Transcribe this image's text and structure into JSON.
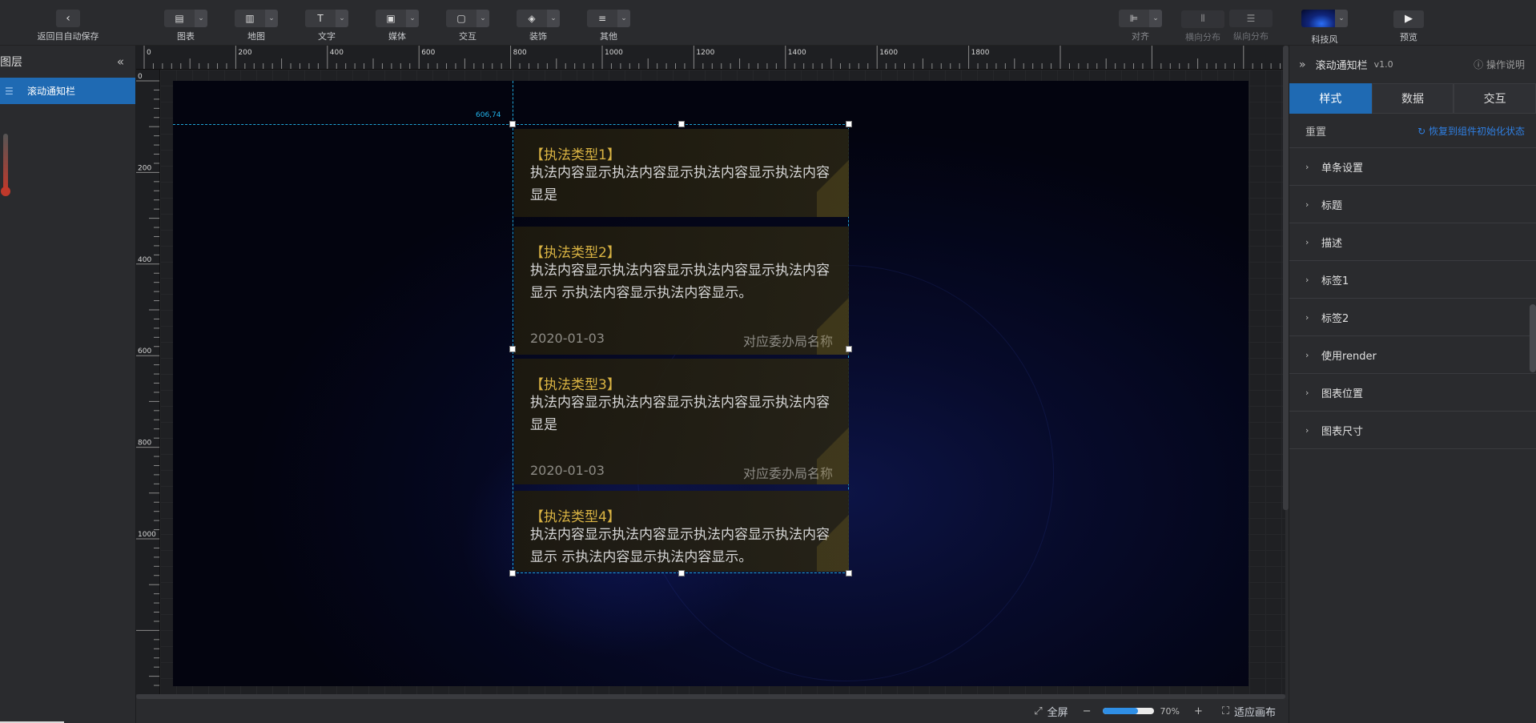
{
  "toolbar": {
    "back_label": "返回目自动保存",
    "groups": [
      {
        "label": "图表",
        "icon": "chart-icon"
      },
      {
        "label": "地图",
        "icon": "map-icon"
      },
      {
        "label": "文字",
        "icon": "text-icon"
      },
      {
        "label": "媒体",
        "icon": "media-icon"
      },
      {
        "label": "交互",
        "icon": "interact-icon"
      },
      {
        "label": "装饰",
        "icon": "decoration-icon"
      },
      {
        "label": "其他",
        "icon": "other-icon"
      }
    ],
    "align_label": "对齐",
    "hdist_label": "横向分布",
    "vdist_label": "纵向分布",
    "theme_label": "科技风",
    "preview_label": "预览"
  },
  "layers": {
    "title": "图层",
    "items": [
      {
        "label": "滚动通知栏"
      }
    ]
  },
  "ruler": {
    "h_ticks": [
      "0",
      "200",
      "400",
      "600",
      "800",
      "1000",
      "1200",
      "1400",
      "1600",
      "1800"
    ],
    "v_ticks": [
      "0",
      "200",
      "400",
      "600",
      "800",
      "1000"
    ]
  },
  "canvas": {
    "guide_label": "606,74",
    "cards": [
      {
        "title": "【执法类型1】",
        "desc": "执法内容显示执法内容显示执法内容显示执法内容显是",
        "date": "",
        "org": ""
      },
      {
        "title": "【执法类型2】",
        "desc": "执法内容显示执法内容显示执法内容显示执法内容显示 示执法内容显示执法内容显示。",
        "date": "2020-01-03",
        "org": "对应委办局名称"
      },
      {
        "title": "【执法类型3】",
        "desc": "执法内容显示执法内容显示执法内容显示执法内容显是",
        "date": "2020-01-03",
        "org": "对应委办局名称"
      },
      {
        "title": "【执法类型4】",
        "desc": "执法内容显示执法内容显示执法内容显示执法内容显示 示执法内容显示执法内容显示。",
        "date": "",
        "org": ""
      }
    ]
  },
  "panel": {
    "title": "滚动通知栏",
    "version": "v1.0",
    "help": "操作说明",
    "tabs": [
      "样式",
      "数据",
      "交互"
    ],
    "active_tab": 0,
    "reset": "重置",
    "restore": "恢复到组件初始化状态",
    "sections": [
      "单条设置",
      "标题",
      "描述",
      "标签1",
      "标签2",
      "使用render",
      "图表位置",
      "图表尺寸"
    ]
  },
  "bottom": {
    "fullscreen": "全屏",
    "zoom": "70%",
    "zoom_fraction": 0.7,
    "fit": "适应画布"
  },
  "colors": {
    "accent": "#1f6ab3",
    "title_gold": "#d9b343",
    "guide": "#1fa3d6"
  }
}
